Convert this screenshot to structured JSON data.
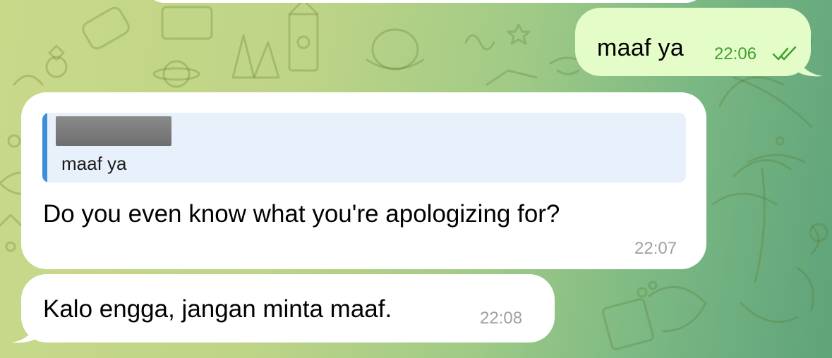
{
  "messages": {
    "outgoing": {
      "text": "maaf ya",
      "time": "22:06",
      "status_icon": "double-check-icon"
    },
    "reply_message": {
      "quoted_sender": "",
      "quoted_text": "maaf ya",
      "text": "Do you even know what you're apologizing for?",
      "time": "22:07"
    },
    "followup_message": {
      "text": "Kalo engga, jangan minta maaf.",
      "time": "22:08"
    }
  },
  "colors": {
    "outgoing_bubble": "#e3fcc8",
    "incoming_bubble": "#ffffff",
    "read_check": "#3ea12e",
    "reply_accent": "#3b8fd9"
  }
}
